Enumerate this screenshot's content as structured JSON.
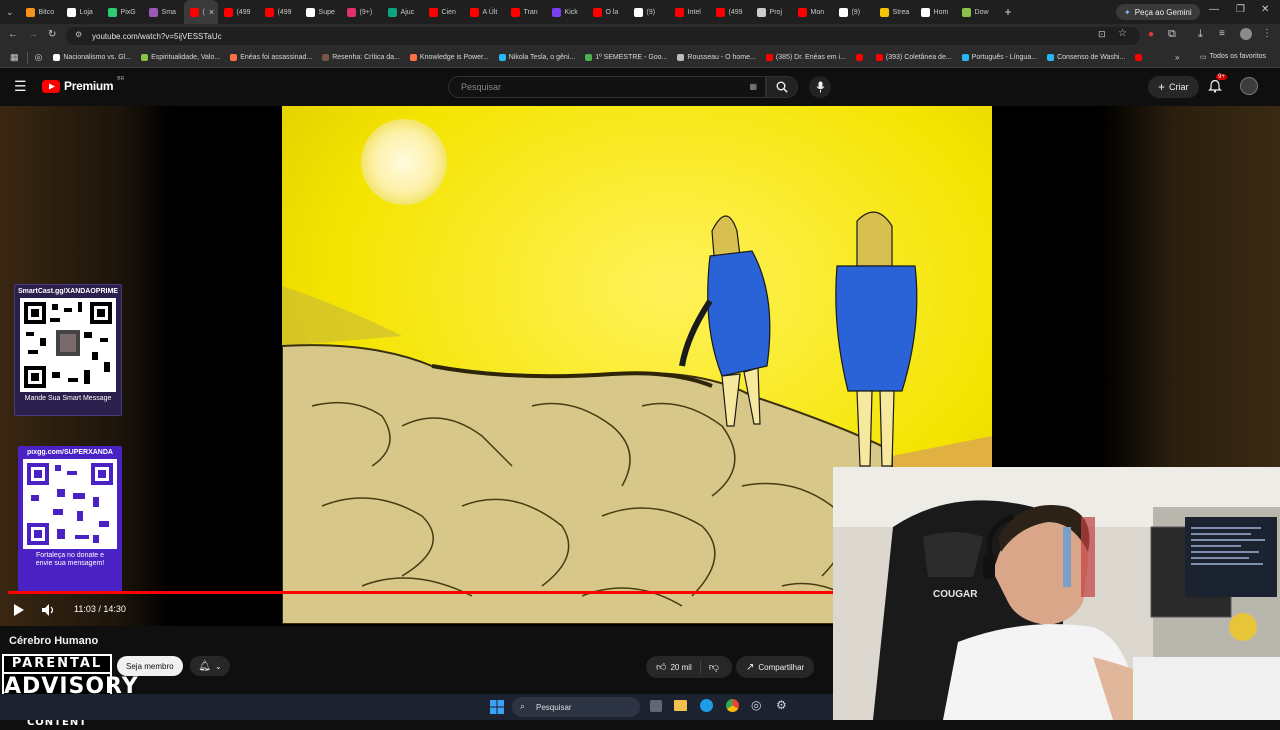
{
  "browser": {
    "tabs": [
      {
        "label": "Bitco",
        "color": "#f7931a"
      },
      {
        "label": "Loja",
        "color": "#ffffff"
      },
      {
        "label": "PixG",
        "color": "#2ecc71"
      },
      {
        "label": "Sma",
        "color": "#9b59b6"
      },
      {
        "label": "(",
        "color": "#ff0000",
        "active": true
      },
      {
        "label": "(499",
        "color": "#ff0000"
      },
      {
        "label": "(499",
        "color": "#ff0000"
      },
      {
        "label": "Supe",
        "color": "#ffffff"
      },
      {
        "label": "(9+)",
        "color": "#e1306c"
      },
      {
        "label": "Ajuc",
        "color": "#10a37f"
      },
      {
        "label": "Cien",
        "color": "#ff0000"
      },
      {
        "label": "A Últ",
        "color": "#ff0000"
      },
      {
        "label": "Tran",
        "color": "#ff0000"
      },
      {
        "label": "Kick",
        "color": "#7b3ff2"
      },
      {
        "label": "O la",
        "color": "#ff0000"
      },
      {
        "label": "(9)",
        "color": "#ffffff"
      },
      {
        "label": "Intel",
        "color": "#ff0000"
      },
      {
        "label": "(499",
        "color": "#ff0000"
      },
      {
        "label": "Proj",
        "color": "#cccccc"
      },
      {
        "label": "Mon",
        "color": "#ff0000"
      },
      {
        "label": "(9)",
        "color": "#ffffff"
      },
      {
        "label": "Strea",
        "color": "#f5c400"
      },
      {
        "label": "Hom",
        "color": "#ffffff"
      },
      {
        "label": "Dow",
        "color": "#8bc34a"
      }
    ],
    "new_tab": "+",
    "gemini_button": "Peça ao Gemini",
    "url": "youtube.com/watch?v=5ijVESSTaUc",
    "bookmarks": [
      {
        "label": "Nacionalismo vs. Gl...",
        "color": "#ffffff"
      },
      {
        "label": "Espiritualidade, Valo...",
        "color": "#8bc34a"
      },
      {
        "label": "Enéas foi assassinad...",
        "color": "#ff7043"
      },
      {
        "label": "Resenha: Crítica da...",
        "color": "#795548"
      },
      {
        "label": "Knowledge is Power...",
        "color": "#ff7043"
      },
      {
        "label": "Nikola Tesla, o gêni...",
        "color": "#29b6f6"
      },
      {
        "label": "1º SEMESTRE - Goo...",
        "color": "#4caf50"
      },
      {
        "label": "Rousseau - O home...",
        "color": "#bdbdbd"
      },
      {
        "label": "(385) Dr. Enéas em i...",
        "color": "#ff0000"
      },
      {
        "label": "",
        "color": "#ff0000"
      },
      {
        "label": "(393) Coletânea de...",
        "color": "#ff0000"
      },
      {
        "label": "Português - Língua...",
        "color": "#29b6f6"
      },
      {
        "label": "Consenso de Washi...",
        "color": "#29b6f6"
      },
      {
        "label": "",
        "color": "#ff0000"
      }
    ],
    "all_favorites": "Todos os favoritos"
  },
  "youtube": {
    "logo": "Premium",
    "region": "BR",
    "search_placeholder": "Pesquisar",
    "create_label": "Criar",
    "notification_badge": "9+",
    "video_title": "Cérebro Humano",
    "time_display": "11:03 / 14:30",
    "progress": 0.7621,
    "member_button": "Seja membro",
    "likes": "20 mil",
    "share_label": "Compartilhar"
  },
  "overlays": {
    "qr1_title": "SmartCast.gg/XANDAOPRIME",
    "qr1_caption": "Mande Sua Smart Message",
    "qr2_title": "pixgg.com/SUPERXANDA",
    "qr2_caption_1": "Fortaleça no donate e",
    "qr2_caption_2": "envie sua mensagem!",
    "advisory_1": "PARENTAL",
    "advisory_2": "ADVISORY",
    "advisory_3": "EXPLICIT CONTENT",
    "webcam_brand": "COUGAR"
  },
  "taskbar": {
    "search_label": "Pesquisar"
  }
}
